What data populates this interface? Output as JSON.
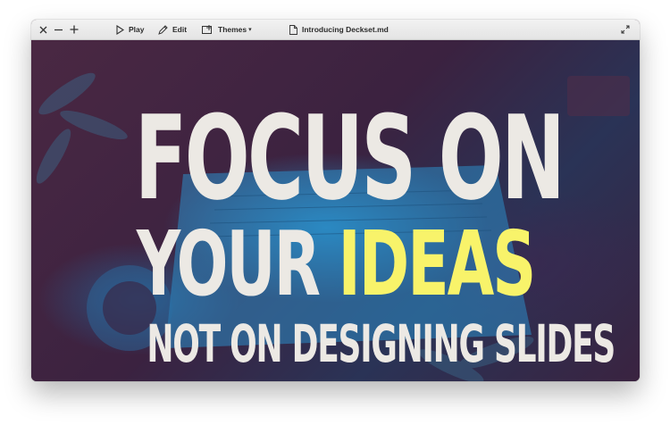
{
  "toolbar": {
    "close_icon": "close-icon",
    "minimize_icon": "minus-icon",
    "zoom_icon": "plus-icon",
    "play_label": "Play",
    "edit_label": "Edit",
    "themes_label": "Themes",
    "document_title": "Introducing Deckset.md",
    "fullscreen_icon": "expand-icon"
  },
  "slide": {
    "line1": "FOCUS ON",
    "line2_part1": "YOUR ",
    "line2_accent": "IDEAS",
    "line3": "NOT ON DESIGNING SLIDES",
    "colors": {
      "text": "#ece9e4",
      "accent": "#f8f36a",
      "background": "#3a2236",
      "duotone_blue": "#2a9ad6"
    }
  }
}
